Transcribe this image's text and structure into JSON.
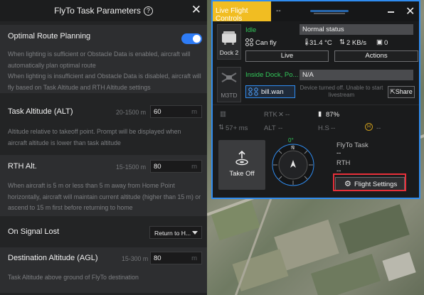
{
  "left_panel": {
    "title": "FlyTo Task Parameters",
    "help_glyph": "?",
    "close_glyph": "✕",
    "optimal_route": {
      "label": "Optimal Route Planning",
      "enabled": true,
      "desc1": "When lighting is sufficient or Obstacle Data is enabled, aircraft will automatically plan optimal route",
      "desc2": "When lighting is insufficient and Obstacle Data is disabled, aircraft will fly based on Task Altitude and RTH Altitude settings"
    },
    "task_altitude": {
      "label": "Task Altitude (ALT)",
      "range": "20-1500 m",
      "value": "60",
      "unit": "m",
      "desc": "Altitude relative to takeoff point. Prompt will be displayed when aircraft altitude is lower than task altitude"
    },
    "rth_alt": {
      "label": "RTH Alt.",
      "range": "15-1500 m",
      "value": "80",
      "unit": "m",
      "desc": "When aircraft is  5 m or less than  5 m away from Home Point horizontally, aircraft will maintain current altitude (higher than  15 m) or ascend to  15 m first before returning to home"
    },
    "signal_lost": {
      "label": "On Signal Lost",
      "selected": "Return to H..."
    },
    "destination_alt": {
      "label": "Destination Altitude (AGL)",
      "range": "15-300 m",
      "value": "80",
      "unit": "m",
      "desc": "Task Altitude above ground of FlyTo destination"
    }
  },
  "flight_controls": {
    "tab_label": "Live Flight Controls",
    "dash": "--",
    "close_glyph": "✕",
    "dock": {
      "name": "Dock 2",
      "status": "Idle",
      "status_text": "Normal status",
      "can_fly": "Can fly",
      "temperature": "31.4 °C",
      "network": "2 KB/s",
      "storage": "0",
      "live_button": "Live",
      "actions_button": "Actions"
    },
    "aircraft": {
      "name": "M3TD",
      "location": "Inside Dock, Po...",
      "status_text": "N/A",
      "pilot": "bill.wan",
      "camera_note": "Device turned off. Unable to start livestream",
      "share_button": "Share",
      "rtk": "RTK",
      "rtk_value": "--",
      "battery": "87%",
      "speed": "57+ ms",
      "alt_label": "ALT",
      "alt_value": "--",
      "hs_label": "H.S",
      "hs_value": "--",
      "home_value": "--"
    },
    "takeoff_button": "Take Off",
    "heading_deg": "0°",
    "heading_north": "N",
    "task_label": "FlyTo Task",
    "task_value": "--",
    "rth_label": "RTH",
    "rth_value": "--",
    "flight_settings_button": "Flight Settings"
  },
  "colors": {
    "accent_blue": "#2f8cf0",
    "tab_yellow": "#f1bd22",
    "status_green": "#32c85a",
    "highlight_red": "#e8303a",
    "toggle_blue": "#2e7cf6"
  }
}
